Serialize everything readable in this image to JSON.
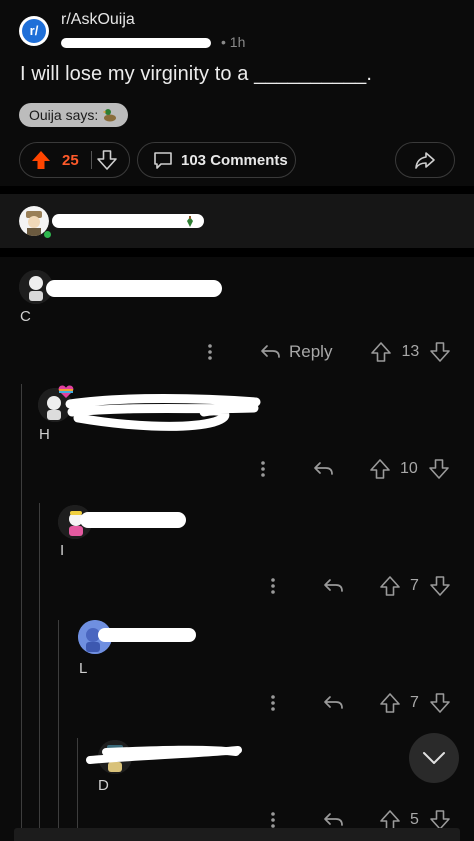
{
  "post": {
    "subreddit": "r/AskOuija",
    "subreddit_icon_text": "r/",
    "time": "1h",
    "title": "I will lose my virginity to a __________.",
    "flair": "Ouija says:",
    "flair_icon": "duck-emoji-icon"
  },
  "actions": {
    "upvotes": "25",
    "comments": "103 Comments"
  },
  "comments": [
    {
      "initial": "C",
      "reply_label": "Reply",
      "votes": "13"
    },
    {
      "initial": "H",
      "votes": "10"
    },
    {
      "initial": "I",
      "votes": "7"
    },
    {
      "initial": "L",
      "votes": "7"
    },
    {
      "initial": "D",
      "votes": "5"
    }
  ],
  "colors": {
    "upvote": "#ff4500",
    "background": "#0b0b0b",
    "subreddit_icon": "#1f6fd8"
  }
}
